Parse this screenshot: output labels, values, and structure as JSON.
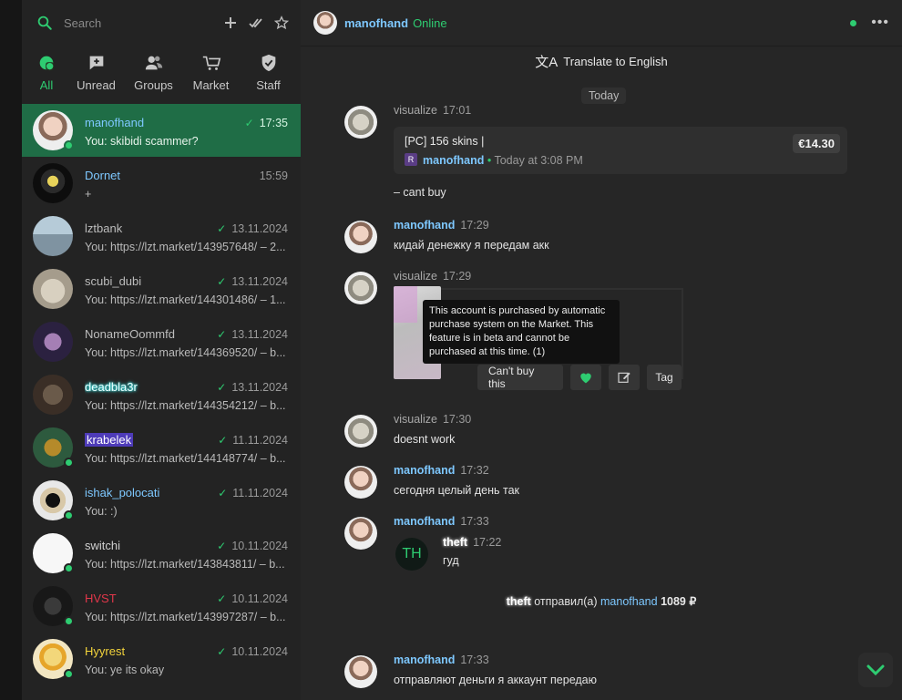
{
  "search": {
    "placeholder": "Search"
  },
  "filters": [
    {
      "label": "All",
      "icon": "chat-bubble-icon"
    },
    {
      "label": "Unread",
      "icon": "unread-icon"
    },
    {
      "label": "Groups",
      "icon": "group-icon"
    },
    {
      "label": "Market",
      "icon": "cart-icon"
    },
    {
      "label": "Staff",
      "icon": "shield-icon"
    }
  ],
  "chats": [
    {
      "name": "manofhand",
      "time": "17:35",
      "preview": "You: skibidi scammer?",
      "read": true,
      "online": true,
      "active": true
    },
    {
      "name": "Dornet",
      "time": "15:59",
      "preview": "+",
      "read": false,
      "online": false
    },
    {
      "name": "lztbank",
      "time": "13.11.2024",
      "preview": "You: https://lzt.market/143957648/ – 2...",
      "read": true,
      "online": false
    },
    {
      "name": "scubi_dubi",
      "time": "13.11.2024",
      "preview": "You: https://lzt.market/144301486/ – 1...",
      "read": true,
      "online": false
    },
    {
      "name": "NonameOommfd",
      "time": "13.11.2024",
      "preview": "You: https://lzt.market/144369520/ – b...",
      "read": true,
      "online": false
    },
    {
      "name": "deadbla3r",
      "time": "13.11.2024",
      "preview": "You: https://lzt.market/144354212/ – b...",
      "read": true,
      "online": false
    },
    {
      "name": "krabelek",
      "time": "11.11.2024",
      "preview": "You: https://lzt.market/144148774/ – b...",
      "read": true,
      "online": true
    },
    {
      "name": "ishak_polocati",
      "time": "11.11.2024",
      "preview": "You: :)",
      "read": true,
      "online": true
    },
    {
      "name": "switchi",
      "time": "10.11.2024",
      "preview": "You: https://lzt.market/143843811/ – b...",
      "read": true,
      "online": true
    },
    {
      "name": "HVST",
      "time": "10.11.2024",
      "preview": "You: https://lzt.market/143997287/ – b...",
      "read": true,
      "online": true
    },
    {
      "name": "Hyyrest",
      "time": "10.11.2024",
      "preview": "You: ye its okay",
      "read": true,
      "online": true
    }
  ],
  "header": {
    "name": "manofhand",
    "status": "Online"
  },
  "translate": {
    "label": "Translate to English"
  },
  "date_divider": "Today",
  "messages": {
    "m1": {
      "author": "visualize",
      "time": "17:01",
      "text": "– cant buy"
    },
    "card": {
      "title": "[PC] 156 skins |",
      "seller": "manofhand",
      "sep": "•",
      "when": "Today at 3:08 PM",
      "price": "€14.30"
    },
    "m2": {
      "author": "manofhand",
      "time": "17:29",
      "text": "кидай денежку я передам акк"
    },
    "m3": {
      "author": "visualize",
      "time": "17:29"
    },
    "tooltip": "This account is purchased by automatic purchase system on the Market. This feature is in beta and cannot be purchased at this time. (1)",
    "buttons": {
      "cant_buy": "Can't buy this",
      "tag": "Tag"
    },
    "m4": {
      "author": "visualize",
      "time": "17:30",
      "text": "doesnt work"
    },
    "m5": {
      "author": "manofhand",
      "time": "17:32",
      "text": "сегодня целый день так"
    },
    "m6": {
      "author": "manofhand",
      "time": "17:33"
    },
    "quote": {
      "initials": "TH",
      "author": "theft",
      "time": "17:22",
      "text": "гуд"
    },
    "system": {
      "from": "theft",
      "verb": "отправил(а)",
      "to": "manofhand",
      "amount": "1089 ₽"
    },
    "m7": {
      "author": "manofhand",
      "time": "17:33",
      "text": "отправляют деньги я аккаунт передаю"
    }
  },
  "colors": {
    "accent": "#2ecc71",
    "active_chat": "#1f6d46",
    "username_blue": "#7ec8ff"
  }
}
